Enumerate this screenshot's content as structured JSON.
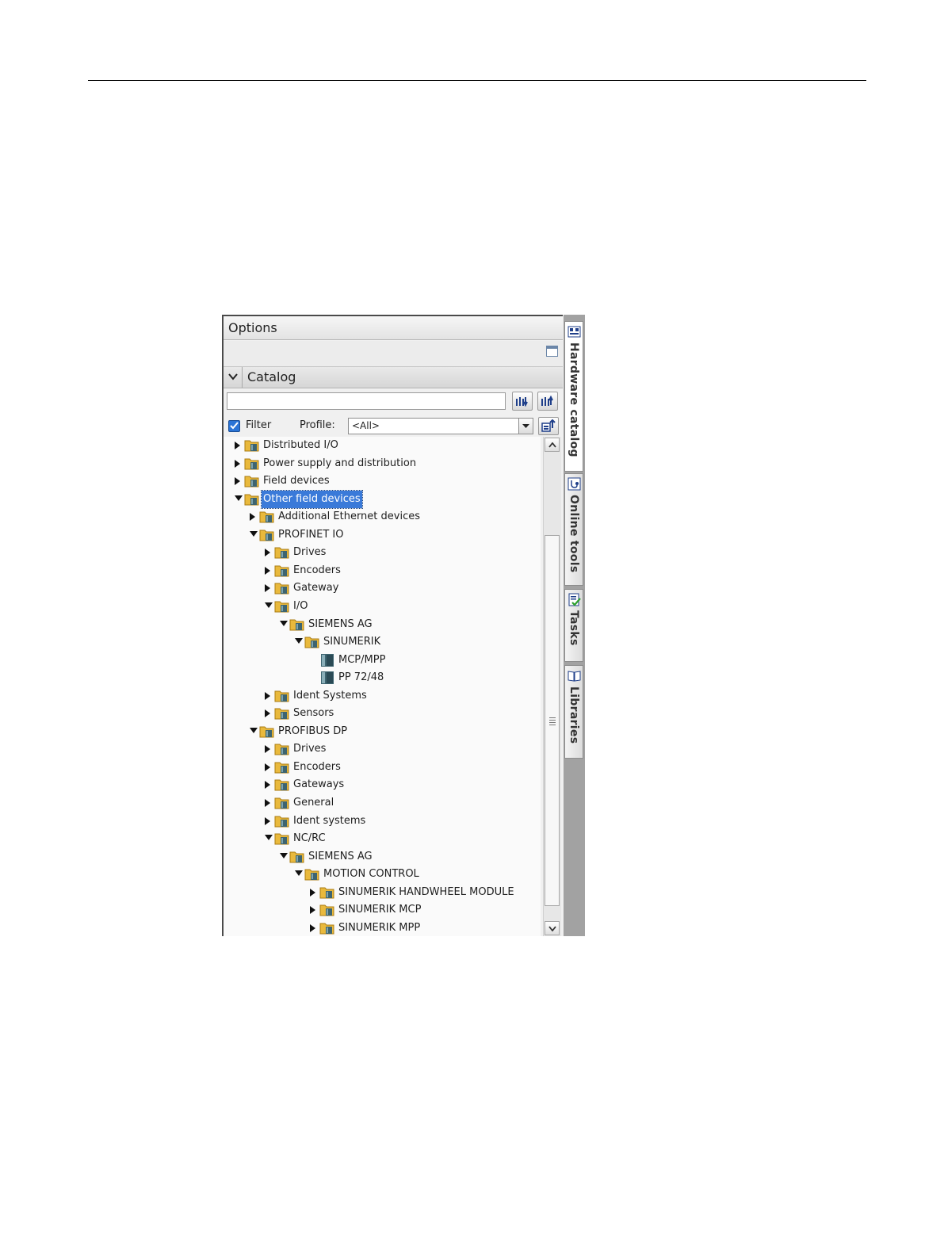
{
  "options": {
    "title": "Options"
  },
  "catalog": {
    "title": "Catalog",
    "search_value": "",
    "filter_label": "Filter",
    "filter_checked": true,
    "profile_label": "Profile:",
    "profile_value": "<All>"
  },
  "tree": [
    {
      "label": "Distributed I/O",
      "level": 0,
      "toggle": "collapsed",
      "icon": "folder-icon"
    },
    {
      "label": "Power supply and distribution",
      "level": 0,
      "toggle": "collapsed",
      "icon": "folder-icon"
    },
    {
      "label": "Field devices",
      "level": 0,
      "toggle": "collapsed",
      "icon": "folder-icon"
    },
    {
      "label": "Other field devices",
      "level": 0,
      "toggle": "expanded",
      "icon": "folder-icon",
      "selected": true
    },
    {
      "label": "Additional Ethernet devices",
      "level": 1,
      "toggle": "collapsed",
      "icon": "folder-icon"
    },
    {
      "label": "PROFINET IO",
      "level": 1,
      "toggle": "expanded",
      "icon": "folder-icon"
    },
    {
      "label": "Drives",
      "level": 2,
      "toggle": "collapsed",
      "icon": "folder-icon"
    },
    {
      "label": "Encoders",
      "level": 2,
      "toggle": "collapsed",
      "icon": "folder-icon"
    },
    {
      "label": "Gateway",
      "level": 2,
      "toggle": "collapsed",
      "icon": "folder-icon"
    },
    {
      "label": "I/O",
      "level": 2,
      "toggle": "expanded",
      "icon": "folder-icon"
    },
    {
      "label": "SIEMENS AG",
      "level": 3,
      "toggle": "expanded",
      "icon": "folder-icon"
    },
    {
      "label": "SINUMERIK",
      "level": 4,
      "toggle": "expanded",
      "icon": "folder-icon"
    },
    {
      "label": "MCP/MPP",
      "level": 5,
      "toggle": "none",
      "icon": "device-icon"
    },
    {
      "label": "PP 72/48",
      "level": 5,
      "toggle": "none",
      "icon": "device-icon"
    },
    {
      "label": "Ident Systems",
      "level": 2,
      "toggle": "collapsed",
      "icon": "folder-icon"
    },
    {
      "label": "Sensors",
      "level": 2,
      "toggle": "collapsed",
      "icon": "folder-icon"
    },
    {
      "label": "PROFIBUS DP",
      "level": 1,
      "toggle": "expanded",
      "icon": "folder-icon"
    },
    {
      "label": "Drives",
      "level": 2,
      "toggle": "collapsed",
      "icon": "folder-icon"
    },
    {
      "label": "Encoders",
      "level": 2,
      "toggle": "collapsed",
      "icon": "folder-icon"
    },
    {
      "label": "Gateways",
      "level": 2,
      "toggle": "collapsed",
      "icon": "folder-icon"
    },
    {
      "label": "General",
      "level": 2,
      "toggle": "collapsed",
      "icon": "folder-icon"
    },
    {
      "label": "Ident systems",
      "level": 2,
      "toggle": "collapsed",
      "icon": "folder-icon"
    },
    {
      "label": "NC/RC",
      "level": 2,
      "toggle": "expanded",
      "icon": "folder-icon"
    },
    {
      "label": "SIEMENS AG",
      "level": 3,
      "toggle": "expanded",
      "icon": "folder-icon"
    },
    {
      "label": "MOTION CONTROL",
      "level": 4,
      "toggle": "expanded",
      "icon": "folder-icon"
    },
    {
      "label": "SINUMERIK HANDWHEEL MODULE",
      "level": 5,
      "toggle": "collapsed",
      "icon": "folder-icon"
    },
    {
      "label": "SINUMERIK MCP",
      "level": 5,
      "toggle": "collapsed",
      "icon": "folder-icon"
    },
    {
      "label": "SINUMERIK MPP",
      "level": 5,
      "toggle": "collapsed",
      "icon": "folder-icon"
    }
  ],
  "side_tabs": [
    {
      "label": "Hardware catalog",
      "icon": "hardware-catalog-icon",
      "active": true
    },
    {
      "label": "Online tools",
      "icon": "online-tools-icon",
      "active": false
    },
    {
      "label": "Tasks",
      "icon": "tasks-icon",
      "active": false
    },
    {
      "label": "Libraries",
      "icon": "libraries-icon",
      "active": false
    }
  ],
  "colors": {
    "selection": "#3a7ad9",
    "folder": "#e9b93c",
    "device": "#3d6470"
  }
}
